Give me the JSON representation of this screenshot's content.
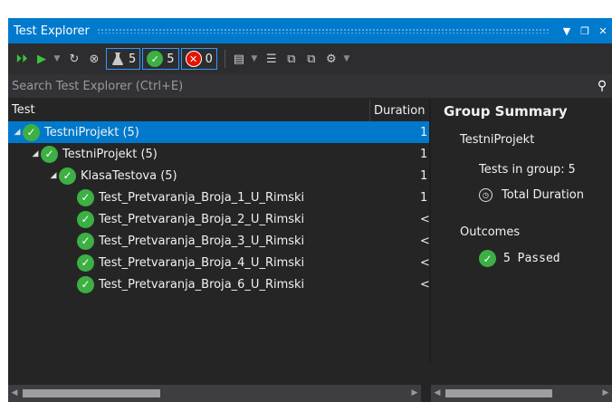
{
  "window": {
    "title": "Test Explorer"
  },
  "toolbar": {
    "passed_count": "5",
    "failed_count": "0",
    "playlist_count": "5"
  },
  "search": {
    "placeholder": "Search Test Explorer (Ctrl+E)"
  },
  "columns": {
    "test": "Test",
    "duration": "Duration"
  },
  "tree": [
    {
      "label": "TestniProjekt (5)",
      "duration": "1",
      "level": 0,
      "selected": true
    },
    {
      "label": "TestniProjekt (5)",
      "duration": "1",
      "level": 1
    },
    {
      "label": "KlasaTestova (5)",
      "duration": "1",
      "level": 2
    },
    {
      "label": "Test_Pretvaranja_Broja_1_U_Rimski",
      "duration": "1",
      "level": 3
    },
    {
      "label": "Test_Pretvaranja_Broja_2_U_Rimski",
      "duration": "<",
      "level": 3
    },
    {
      "label": "Test_Pretvaranja_Broja_3_U_Rimski",
      "duration": "<",
      "level": 3
    },
    {
      "label": "Test_Pretvaranja_Broja_4_U_Rimski",
      "duration": "<",
      "level": 3
    },
    {
      "label": "Test_Pretvaranja_Broja_6_U_Rimski",
      "duration": "<",
      "level": 3
    }
  ],
  "summary": {
    "title": "Group Summary",
    "group_name": "TestniProjekt",
    "tests_in_group_label": "Tests in group:",
    "tests_in_group_value": "5",
    "total_duration_label": "Total Duration",
    "outcomes_label": "Outcomes",
    "passed_text": "5 Passed"
  }
}
